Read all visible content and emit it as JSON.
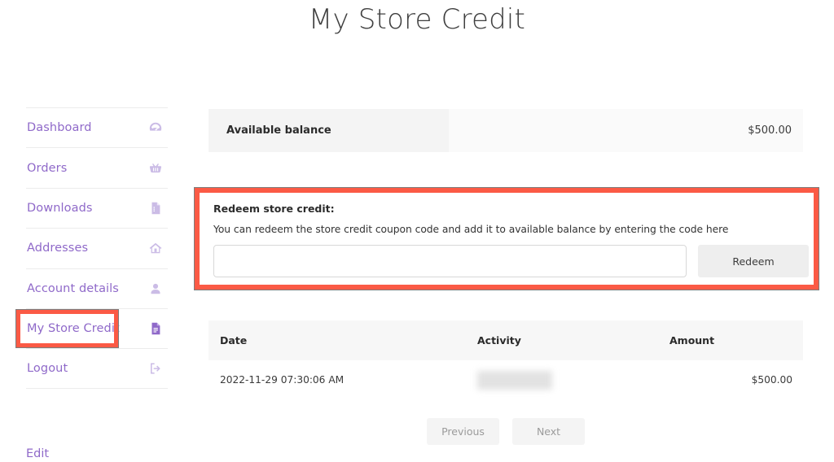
{
  "page": {
    "title": "My Store Credit"
  },
  "sidebar": {
    "items": [
      {
        "label": "Dashboard",
        "icon": "dashboard-icon",
        "active": false
      },
      {
        "label": "Orders",
        "icon": "basket-icon",
        "active": false
      },
      {
        "label": "Downloads",
        "icon": "download-file-icon",
        "active": false
      },
      {
        "label": "Addresses",
        "icon": "home-icon",
        "active": false
      },
      {
        "label": "Account details",
        "icon": "user-icon",
        "active": false
      },
      {
        "label": "My Store Credit",
        "icon": "document-icon",
        "active": true
      },
      {
        "label": "Logout",
        "icon": "logout-icon",
        "active": false
      }
    ],
    "edit_link": "Edit",
    "link_color": "#8f69c9",
    "icon_color": "#cbbce6",
    "active_icon_color": "#8f69c9"
  },
  "balance": {
    "label": "Available balance",
    "amount": "$500.00"
  },
  "redeem": {
    "title": "Redeem store credit:",
    "description": "You can redeem the store credit coupon code and add it to available balance by entering the code here",
    "input_value": "",
    "input_placeholder": "",
    "button_label": "Redeem",
    "highlight_color": "#fb5a45"
  },
  "history": {
    "columns": [
      "Date",
      "Activity",
      "Amount"
    ],
    "rows": [
      {
        "date": "2022-11-29 07:30:06 AM",
        "activity": "",
        "activity_redacted": true,
        "amount": "$500.00"
      }
    ]
  },
  "pagination": {
    "previous_label": "Previous",
    "next_label": "Next"
  }
}
